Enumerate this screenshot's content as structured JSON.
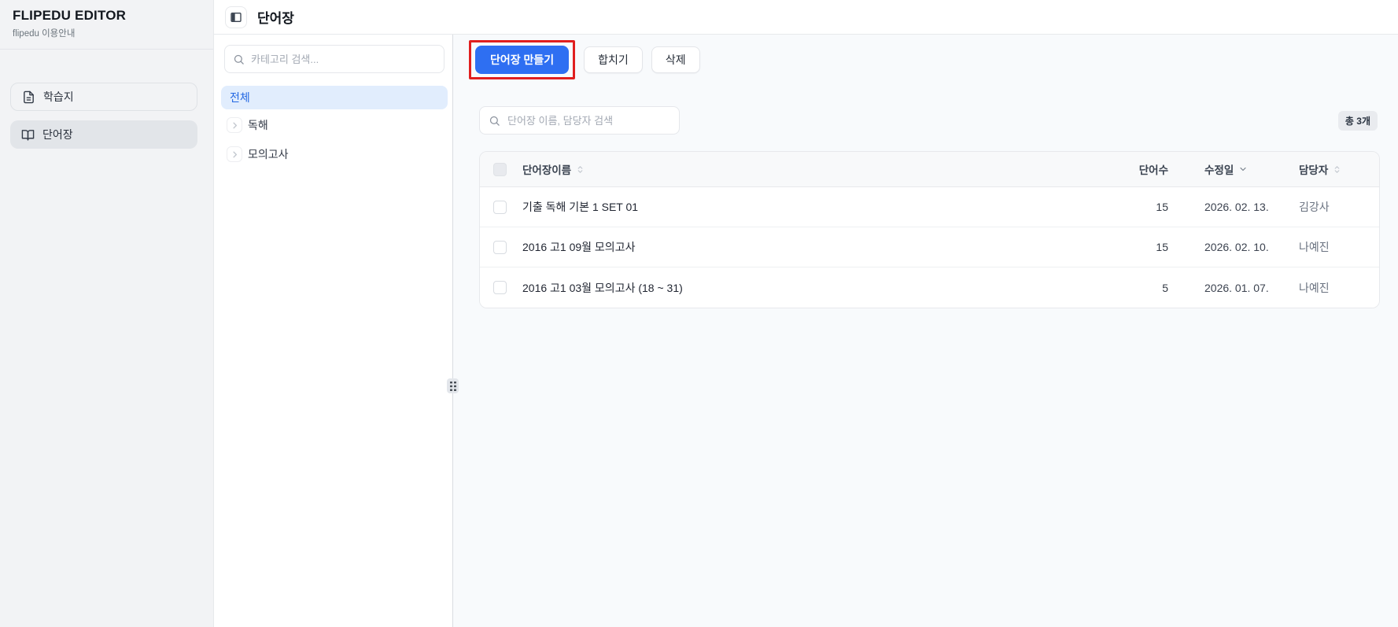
{
  "sidebar": {
    "title": "FLIPEDU EDITOR",
    "subtitle": "flipedu 이용안내",
    "items": [
      {
        "label": "학습지",
        "icon": "worksheet-file-icon",
        "active": false
      },
      {
        "label": "단어장",
        "icon": "wordbook-open-book-icon",
        "active": true
      }
    ]
  },
  "header": {
    "title": "단어장"
  },
  "category_panel": {
    "search_placeholder": "카테고리 검색...",
    "all_label": "전체",
    "items": [
      {
        "label": "독해"
      },
      {
        "label": "모의고사"
      }
    ]
  },
  "main": {
    "toolbar": {
      "create_label": "단어장 만들기",
      "merge_label": "합치기",
      "delete_label": "삭제"
    },
    "search_placeholder": "단어장 이름, 담당자 검색",
    "total_badge": "총 3개",
    "table": {
      "columns": [
        "단어장이름",
        "단어수",
        "수정일",
        "담당자"
      ],
      "sort": {
        "active_column": "수정일",
        "direction": "desc"
      },
      "rows": [
        {
          "name": "기출 독해 기본 1 SET 01",
          "word_count": "15",
          "modified": "2026. 02. 13.",
          "manager": "김강사"
        },
        {
          "name": "2016 고1 09월 모의고사",
          "word_count": "15",
          "modified": "2026. 02. 10.",
          "manager": "나예진"
        },
        {
          "name": "2016 고1 03월 모의고사 (18 ~ 31)",
          "word_count": "5",
          "modified": "2026. 01. 07.",
          "manager": "나예진"
        }
      ]
    }
  },
  "icons": {
    "search": "magnifier",
    "sidebar_toggle": "panel-left",
    "tree_expand": "chevron-right",
    "sortable": "chevrons-up-down",
    "sorted_desc": "chevron-down",
    "resizer": "grip-dots"
  },
  "colors": {
    "accent_blue": "#2e6ff2",
    "annotation_red": "#e01f1f",
    "selected_category_bg": "#e1edfd",
    "selected_category_text": "#2569e3",
    "sidebar_bg": "#f2f3f5",
    "active_nav_bg": "#e2e5e9",
    "main_bg": "#f8fafc",
    "table_header_bg": "#f8f9fa"
  }
}
